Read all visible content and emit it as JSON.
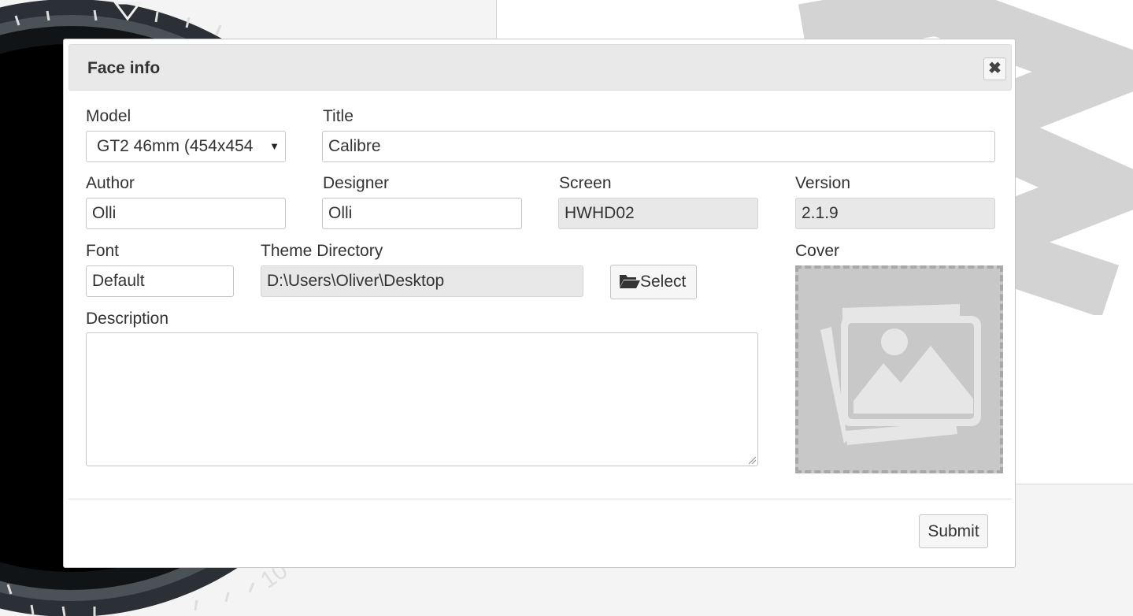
{
  "dialog": {
    "title": "Face info",
    "close_icon": "close-icon"
  },
  "form": {
    "model": {
      "label": "Model",
      "value": "GT2 46mm (454x454"
    },
    "title": {
      "label": "Title",
      "value": "Calibre"
    },
    "author": {
      "label": "Author",
      "value": "Olli"
    },
    "designer": {
      "label": "Designer",
      "value": "Olli"
    },
    "screen": {
      "label": "Screen",
      "value": "HWHD02"
    },
    "version": {
      "label": "Version",
      "value": "2.1.9"
    },
    "font": {
      "label": "Font",
      "value": "Default"
    },
    "theme_directory": {
      "label": "Theme Directory",
      "value": "D:\\Users\\Oliver\\Desktop",
      "select_label": "Select",
      "select_icon": "folder-open-icon"
    },
    "cover": {
      "label": "Cover",
      "placeholder_icon": "image-placeholder-icon"
    },
    "description": {
      "label": "Description",
      "value": ""
    }
  },
  "footer": {
    "submit_label": "Submit"
  },
  "colors": {
    "titlebar_bg": "#e9e9e9",
    "readonly_bg": "#e8e8e8",
    "cover_bg": "#c8c8c8"
  }
}
